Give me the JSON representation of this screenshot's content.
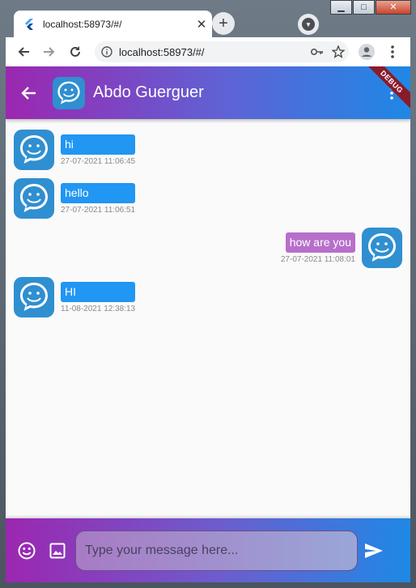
{
  "browser": {
    "tab": {
      "title": "localhost:58973/#/"
    },
    "url": "localhost:58973/#/",
    "window_controls": {
      "minimize": "▁",
      "maximize": "□",
      "close": "✕"
    }
  },
  "app": {
    "title": "Abdo Guerguer",
    "debug_banner": "DEBUG",
    "messages": [
      {
        "text": "hi",
        "time": "27-07-2021 11:06:45",
        "side": "left"
      },
      {
        "text": "hello",
        "time": "27-07-2021 11:06:51",
        "side": "left"
      },
      {
        "text": "how are you",
        "time": "27-07-2021 11:08:01",
        "side": "right"
      },
      {
        "text": "HI",
        "time": "11-08-2021 12:38:13",
        "side": "left"
      }
    ],
    "input": {
      "placeholder": "Type your message here...",
      "value": ""
    }
  },
  "colors": {
    "incoming_bubble": "#2196f3",
    "outgoing_bubble": "#b86fcb",
    "gradient_start": "#9c27b0",
    "gradient_end": "#1e88e5"
  },
  "icons": {
    "back": "arrow-left-icon",
    "more": "more-vert-icon",
    "emoji": "emoji-icon",
    "image": "image-icon",
    "send": "send-icon",
    "avatar": "chat-smile-icon"
  }
}
